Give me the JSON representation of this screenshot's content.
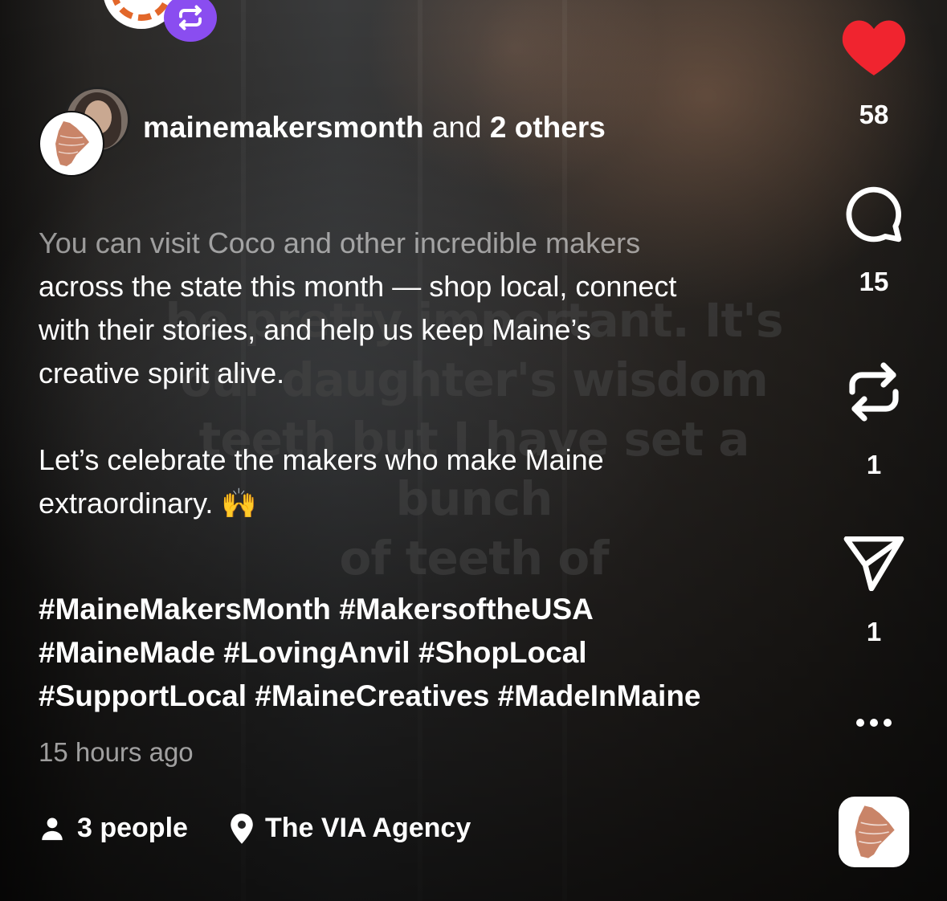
{
  "post": {
    "author_primary": "mainemakersmonth",
    "author_joiner": "and",
    "author_others": "2 others",
    "caption_faded": "You can visit Coco and other incredible makers",
    "caption_lines": [
      "across the state this month — shop local, connect",
      "with their stories, and help us keep Maine’s",
      "creative spirit alive."
    ],
    "caption_p2_line1": "Let’s celebrate the makers who make Maine",
    "caption_p2_line2": "extraordinary. 🙌",
    "hashtag_lines": [
      "#MaineMakersMonth #MakersoftheUSA",
      "#MaineMade #LovingAnvil #ShopLocal",
      "#SupportLocal #MaineCreatives #MadeInMaine"
    ],
    "time_ago": "15 hours ago",
    "people": "3 people",
    "location": "The VIA Agency"
  },
  "video_overlay_text": [
    "be pretty important. It's",
    "our daughter's wisdom",
    "teeth but I have set a bunch",
    "of teeth of"
  ],
  "actions": {
    "likes": "58",
    "comments": "15",
    "reposts": "1",
    "shares": "1"
  },
  "colors": {
    "like": "#f0242f",
    "repost_badge": "#8a4df0",
    "logo": "#c98468"
  },
  "icons": [
    "heart-icon",
    "comment-icon",
    "repost-icon",
    "send-icon",
    "more-icon",
    "person-icon",
    "location-pin-icon",
    "maine-logo-icon"
  ]
}
